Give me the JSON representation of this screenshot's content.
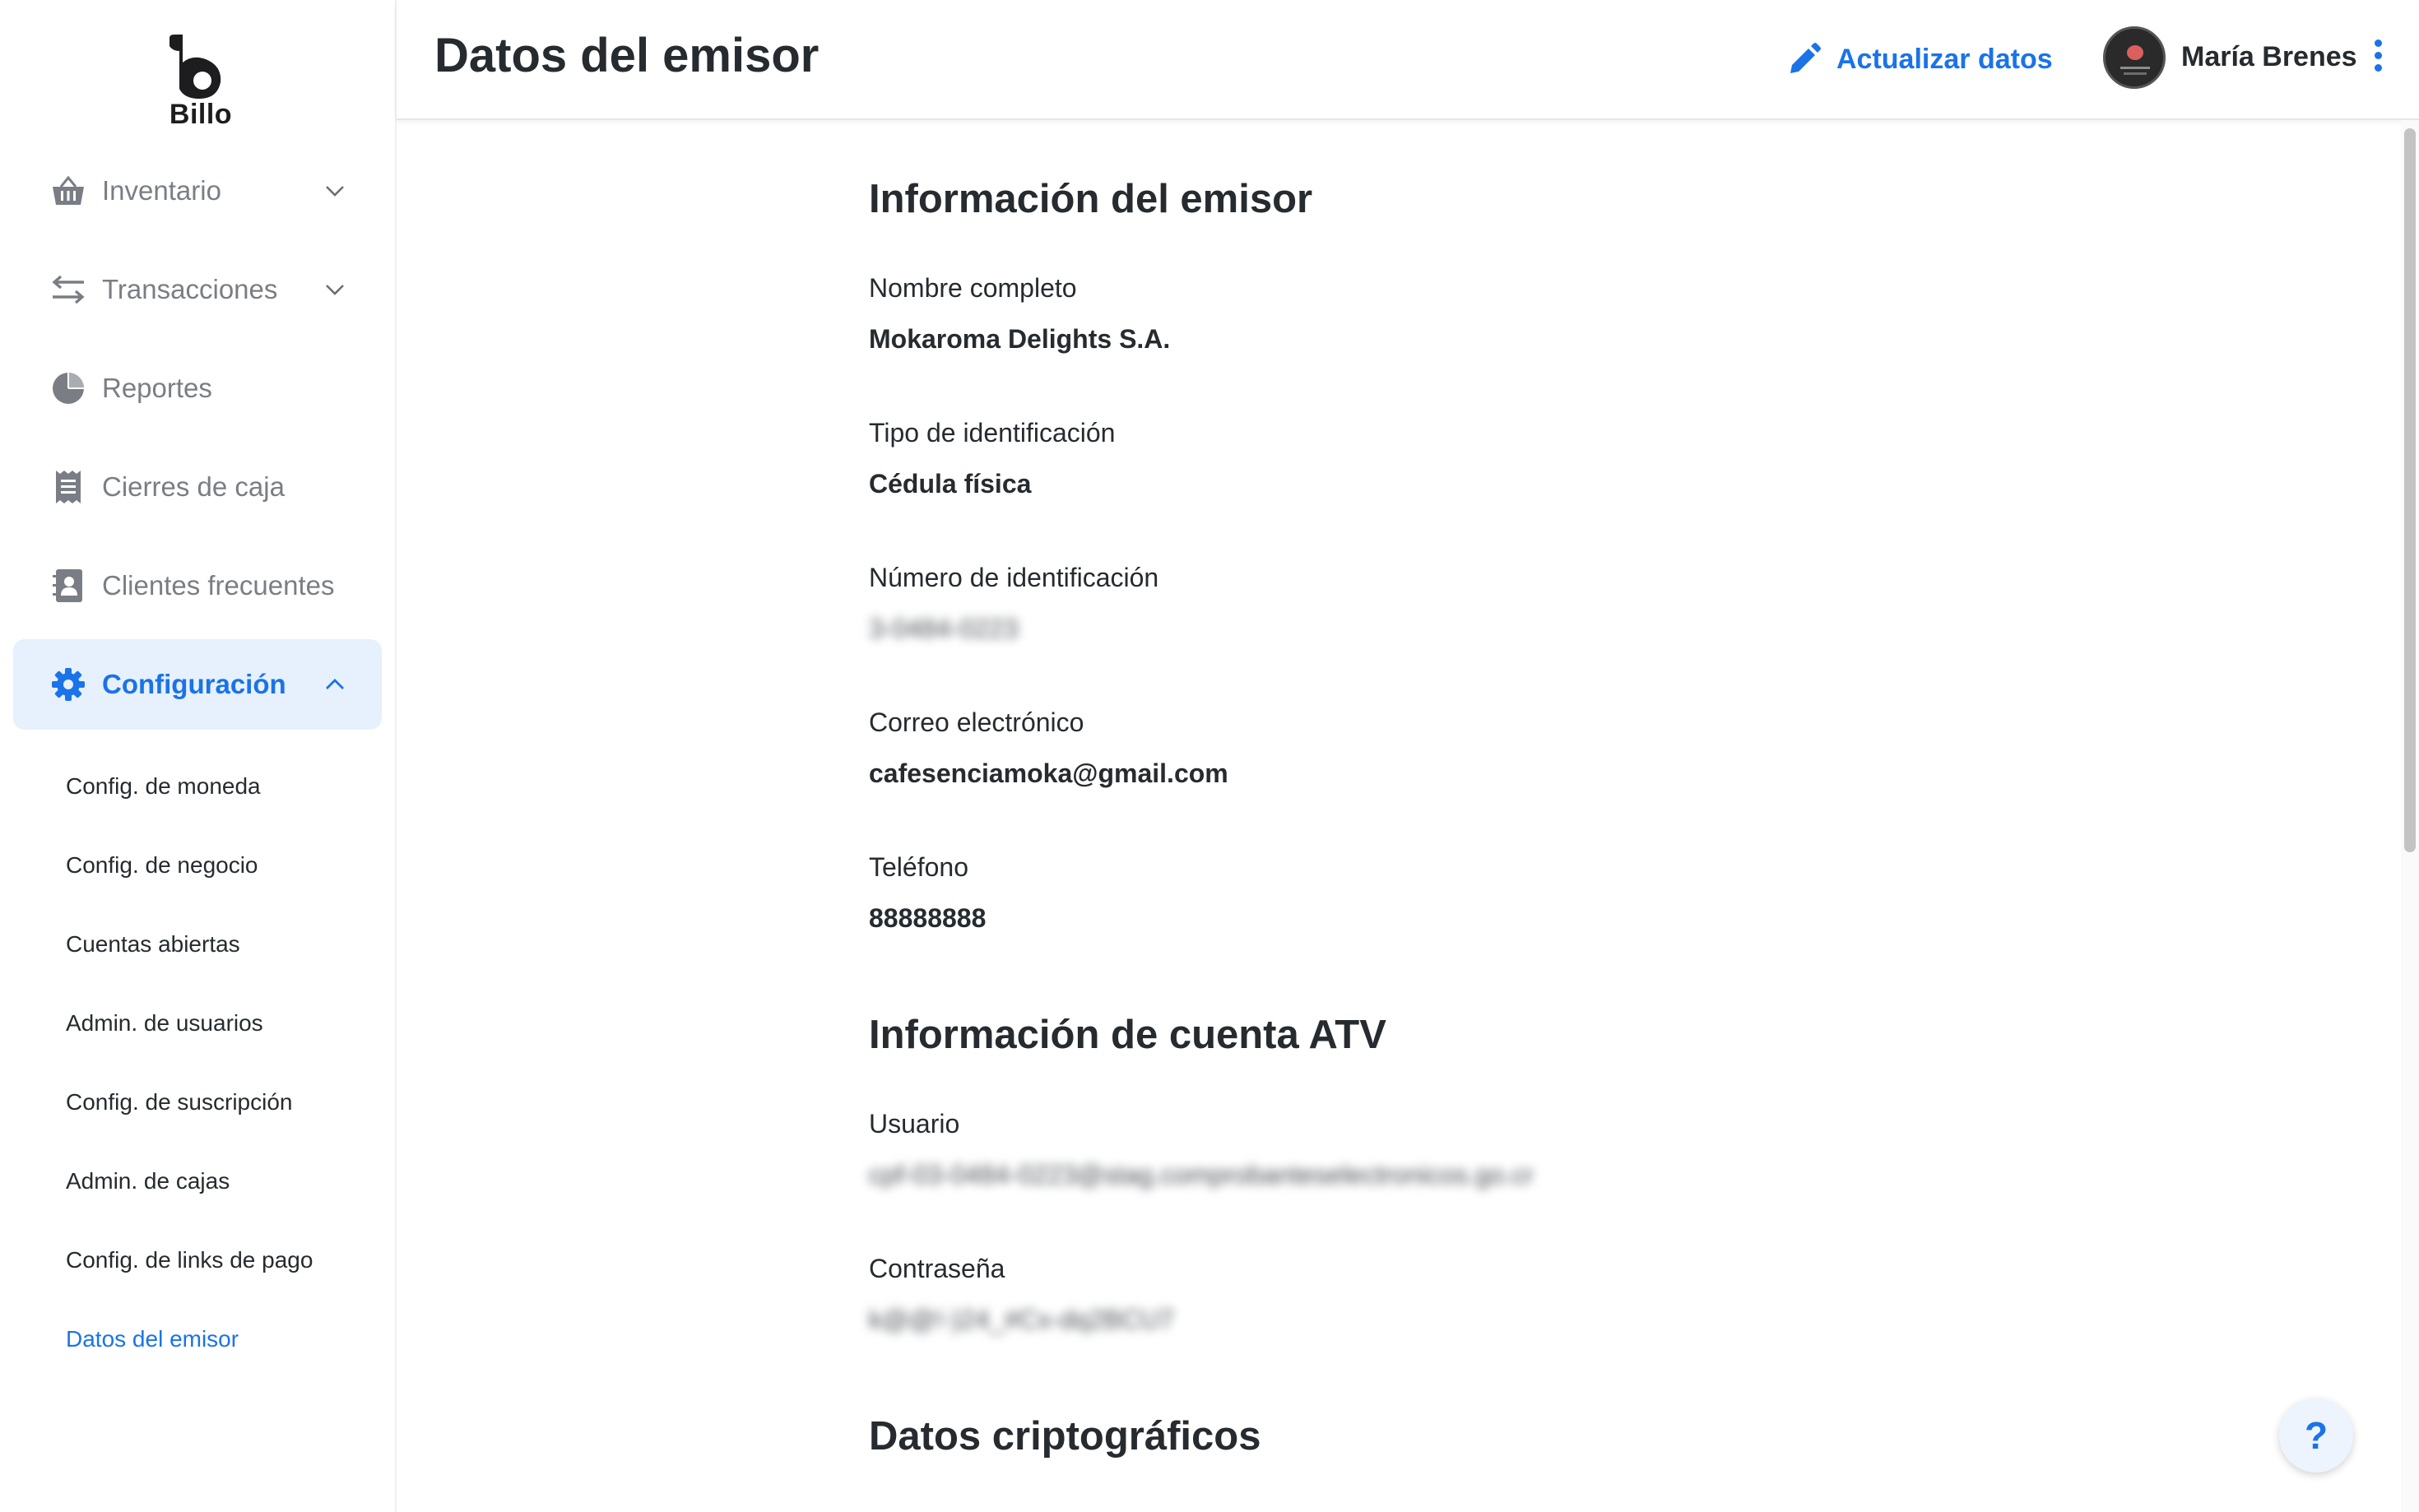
{
  "brand": {
    "name": "Billo"
  },
  "sidebar": {
    "items": [
      {
        "label": "Inventario",
        "icon": "basket-icon",
        "has_chevron": true
      },
      {
        "label": "Transacciones",
        "icon": "arrows-exchange-icon",
        "has_chevron": true
      },
      {
        "label": "Reportes",
        "icon": "pie-chart-icon",
        "has_chevron": false
      },
      {
        "label": "Cierres de caja",
        "icon": "receipt-icon",
        "has_chevron": false
      },
      {
        "label": "Clientes frecuentes",
        "icon": "contact-book-icon",
        "has_chevron": false
      },
      {
        "label": "Configuración",
        "icon": "gear-icon",
        "has_chevron": true,
        "expanded": true,
        "active": true
      }
    ],
    "sub_items": [
      {
        "label": "Config. de moneda"
      },
      {
        "label": "Config. de negocio"
      },
      {
        "label": "Cuentas abiertas"
      },
      {
        "label": "Admin. de usuarios"
      },
      {
        "label": "Config. de suscripción"
      },
      {
        "label": "Admin. de cajas"
      },
      {
        "label": "Config. de links de pago"
      },
      {
        "label": "Datos del emisor",
        "active": true
      }
    ]
  },
  "header": {
    "title": "Datos del emisor",
    "update_label": "Actualizar datos",
    "user_name": "María Brenes"
  },
  "sections": {
    "emisor": {
      "title": "Información del emisor",
      "fields": [
        {
          "label": "Nombre completo",
          "value": "Mokaroma Delights S.A."
        },
        {
          "label": "Tipo de identificación",
          "value": "Cédula física"
        },
        {
          "label": "Número de identificación",
          "value": "3-0484-0223",
          "blurred": true
        },
        {
          "label": "Correo electrónico",
          "value": "cafesenciamoka@gmail.com"
        },
        {
          "label": "Teléfono",
          "value": "88888888"
        }
      ]
    },
    "atv": {
      "title": "Información de cuenta ATV",
      "fields": [
        {
          "label": "Usuario",
          "value": "cpf-03-0484-0223@stag.comprobanteselectronicos.go.cr",
          "blurred": true
        },
        {
          "label": "Contraseña",
          "value": "k@@!-)24_#Cx-dq2BCU7",
          "blurred": true
        }
      ]
    },
    "crypto": {
      "title": "Datos criptográficos"
    }
  },
  "help": {
    "label": "?"
  },
  "colors": {
    "accent": "#1a73e8",
    "active_bg": "#e7f0fd",
    "text": "#262b30",
    "muted": "#7a7e84"
  }
}
